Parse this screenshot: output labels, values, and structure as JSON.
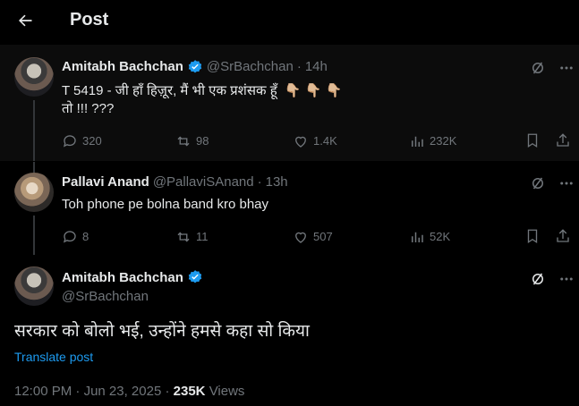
{
  "header": {
    "title": "Post",
    "back_icon": "arrow-left-icon"
  },
  "colors": {
    "background": "#000000",
    "text": "#e7e9ea",
    "muted": "#71767b",
    "accent": "#1d9bf0",
    "verified": "#1d9bf0"
  },
  "tweets": [
    {
      "name": "Amitabh Bachchan",
      "verified": true,
      "handle": "@SrBachchan",
      "separator": "·",
      "time": "14h",
      "text_line1": "T 5419 - जी हाँ हिज़ूर, मैं भी एक प्रशंसक हूँ",
      "emoji": "👇🏼 👇🏼 👇🏼",
      "text_line2": "तो !!! ???",
      "replies": "320",
      "reposts": "98",
      "likes": "1.4K",
      "views": "232K"
    },
    {
      "name": "Pallavi Anand",
      "verified": false,
      "handle": "@PallaviSAnand",
      "separator": "·",
      "time": "13h",
      "text_line1": "Toh phone pe bolna band kro bhay",
      "replies": "8",
      "reposts": "11",
      "likes": "507",
      "views": "52K"
    }
  ],
  "main_post": {
    "name": "Amitabh Bachchan",
    "verified": true,
    "handle": "@SrBachchan",
    "text": "सरकार को बोलो भई, उन्होंने हमसे कहा सो किया",
    "translate_label": "Translate post",
    "time": "12:00 PM",
    "date_separator": "·",
    "date": "Jun 23, 2025",
    "views_separator": "·",
    "views_count": "235K",
    "views_label": "Views"
  }
}
